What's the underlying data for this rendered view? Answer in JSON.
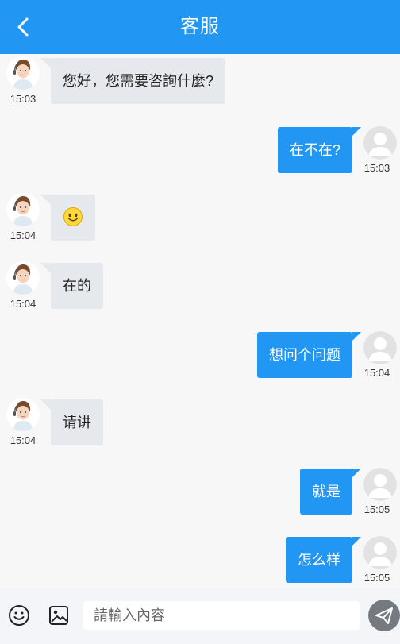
{
  "header": {
    "title": "客服"
  },
  "messages": [
    {
      "side": "left",
      "text": "您好，您需要咨詢什麼?",
      "time": "15:03"
    },
    {
      "side": "right",
      "text": "在不在?",
      "time": "15:03"
    },
    {
      "side": "left",
      "emoji": "smiley",
      "time": "15:04"
    },
    {
      "side": "left",
      "text": "在的",
      "time": "15:04"
    },
    {
      "side": "right",
      "text": "想问个问题",
      "time": "15:04"
    },
    {
      "side": "left",
      "text": "请讲",
      "time": "15:04"
    },
    {
      "side": "right",
      "text": "就是",
      "time": "15:05"
    },
    {
      "side": "right",
      "text": "怎么样",
      "time": "15:05"
    }
  ],
  "composer": {
    "placeholder": "請輸入內容"
  },
  "colors": {
    "accent": "#2196f3",
    "bubble_agent": "#e5e8ed",
    "background": "#f7f7f7"
  }
}
